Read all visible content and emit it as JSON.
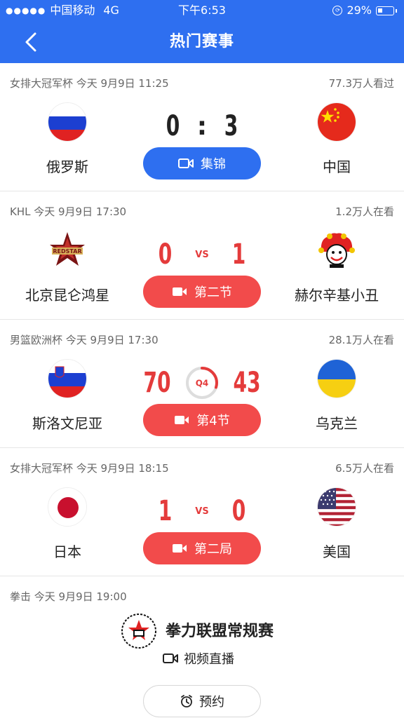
{
  "status_bar": {
    "carrier": "中国移动",
    "network": "4G",
    "time": "下午6:53",
    "battery": "29%"
  },
  "header": {
    "title": "热门赛事"
  },
  "matches": [
    {
      "meta": "女排大冠军杯 今天 9月9日 11:25",
      "views": "77.3万人看过",
      "home": {
        "name": "俄罗斯",
        "flag": "russia-flag"
      },
      "away": {
        "name": "中国",
        "flag": "china-flag"
      },
      "home_score": "0",
      "away_score": "3",
      "action": "集锦"
    },
    {
      "meta": "KHL 今天 9月9日 17:30",
      "views": "1.2万人在看",
      "home": {
        "name": "北京昆仑鸿星",
        "flag": "redstar-logo"
      },
      "away": {
        "name": "赫尔辛基小丑",
        "flag": "jokerit-logo"
      },
      "home_score": "0",
      "vs": "VS",
      "away_score": "1",
      "action": "第二节"
    },
    {
      "meta": "男篮欧洲杯 今天 9月9日 17:30",
      "views": "28.1万人在看",
      "home": {
        "name": "斯洛文尼亚",
        "flag": "slovenia-flag"
      },
      "away": {
        "name": "乌克兰",
        "flag": "ukraine-flag"
      },
      "home_score": "70",
      "quarter": "Q4",
      "quarter_progress": 0.3,
      "away_score": "43",
      "action": "第4节"
    },
    {
      "meta": "女排大冠军杯 今天 9月9日 18:15",
      "views": "6.5万人在看",
      "home": {
        "name": "日本",
        "flag": "japan-flag"
      },
      "away": {
        "name": "美国",
        "flag": "usa-flag"
      },
      "home_score": "1",
      "vs": "VS",
      "away_score": "0",
      "action": "第二局"
    },
    {
      "meta": "拳击 今天 9月9日 19:00",
      "event": "拳力联盟常规赛",
      "live_label": "视频直播",
      "action": "预约"
    }
  ],
  "colors": {
    "brand": "#2e6ff0",
    "live": "#f24b4b",
    "score_red": "#e43b3b"
  }
}
